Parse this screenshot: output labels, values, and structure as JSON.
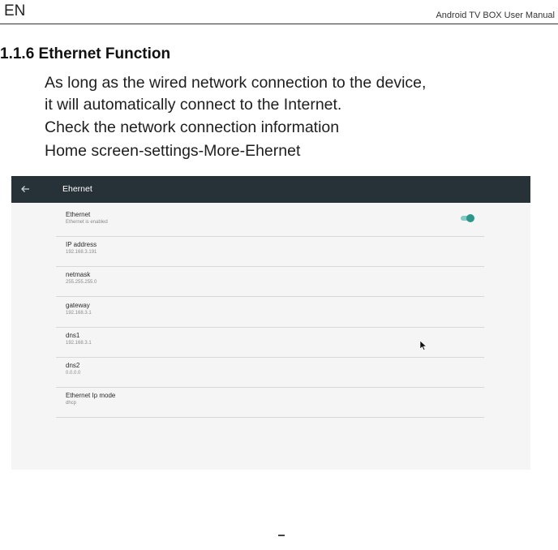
{
  "header": {
    "lang": "EN",
    "manual_title": "Android  TV  BOX  User  Manual"
  },
  "section": {
    "heading": "1.1.6 Ethernet Function",
    "lines": [
      "As long as the wired network connection to the device,",
      "it will automatically connect to the Internet.",
      "Check the network connection information",
      "Home screen-settings-More-Ehernet"
    ]
  },
  "screen": {
    "topbar": {
      "back_icon": "arrow-left-icon",
      "title": "Ehernet"
    },
    "colors": {
      "topbar": "#263238",
      "background": "#f5f5f5",
      "toggle_thumb": "#2e9688",
      "toggle_track": "#80cbc4"
    },
    "rows": [
      {
        "title": "Ethernet",
        "value": "Ethernet is enabled",
        "toggle_on": true
      },
      {
        "title": "IP address",
        "value": "192.168.3.191"
      },
      {
        "title": "netmask",
        "value": "255.255.255.0"
      },
      {
        "title": "gateway",
        "value": "192.168.3.1"
      },
      {
        "title": "dns1",
        "value": "192.168.3.1"
      },
      {
        "title": "dns2",
        "value": "0.0.0.0"
      },
      {
        "title": "Ethernet Ip mode",
        "value": "dhcp"
      }
    ]
  }
}
